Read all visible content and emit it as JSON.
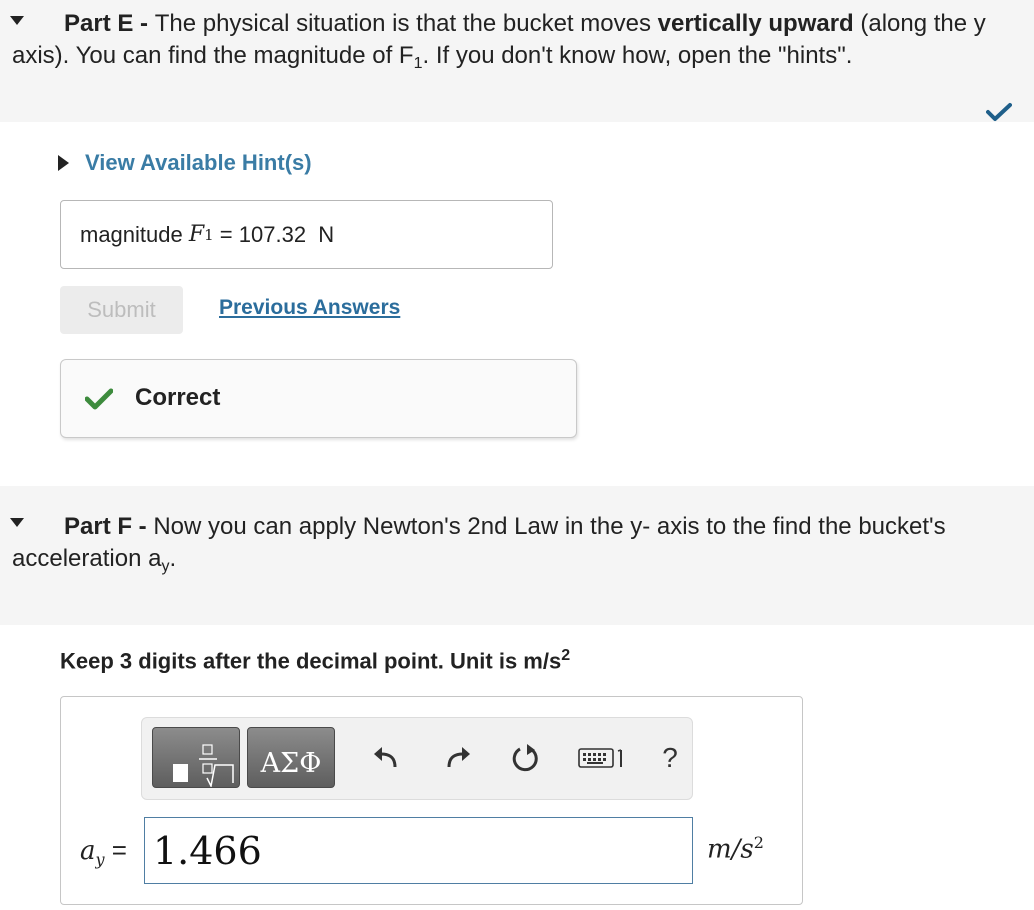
{
  "partE": {
    "label": "Part E",
    "sep": " - ",
    "text_a": "The physical situation is that the bucket moves ",
    "bold": "vertically upward",
    "text_b": " (along the y axis). You can find the magnitude of F",
    "sub": "1",
    "text_c": ". If you don't know how,  open the \"hints\".",
    "hint_link": "View Available Hint(s)",
    "answer": {
      "label": "magnitude ",
      "var": "F",
      "var_sub": "1",
      "eq": " = ",
      "value": "107.32",
      "unit": "N"
    },
    "submit": "Submit",
    "previous_answers": "Previous Answers",
    "feedback": "Correct",
    "status_color": "#1f5f8a",
    "correct_color": "#3d8b3d"
  },
  "partF": {
    "label": "Part F",
    "sep": " - ",
    "text_a": "Now you can apply Newton's 2nd Law in the y- axis to the find the bucket's acceleration a",
    "sub": "y",
    "text_b": ".",
    "instruction": "Keep 3 digits after the decimal point. Unit is m/s",
    "instruction_sup": "2",
    "toolbar": {
      "template_icon": "fraction-root-template-icon",
      "greek_label": "ΑΣΦ",
      "undo_icon": "undo-icon",
      "redo_icon": "redo-icon",
      "reset_icon": "reset-icon",
      "keyboard_icon": "keyboard-icon",
      "help_label": "?"
    },
    "variable": "a",
    "variable_sub": "y",
    "eq": " =",
    "input_value": "1.466",
    "unit_base": "m/s",
    "unit_sup": "2"
  }
}
